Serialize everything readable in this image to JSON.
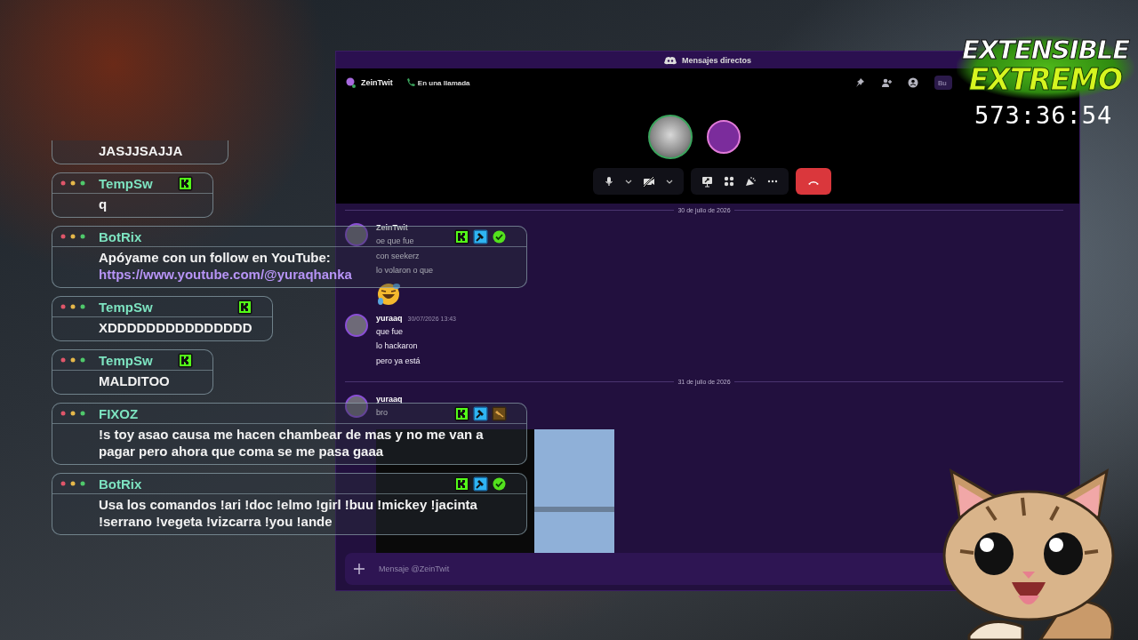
{
  "discord": {
    "title": "Mensajes directos",
    "channel": {
      "name": "ZeinTwit",
      "status": "En una llamada"
    },
    "search": {
      "placeholder": "Bu"
    },
    "messages": [
      {
        "kind": "divider",
        "text": "30 de julio de 2026"
      },
      {
        "kind": "group",
        "author": "ZeinTwit",
        "lines": [
          "oe que fue",
          "con seekerz",
          "lo volaron o que"
        ],
        "attachments": [
          {
            "kind": "emoji"
          }
        ]
      },
      {
        "kind": "group",
        "author": "yuraaq",
        "time": "30/07/2026 13:43",
        "lines": [
          "que fue",
          "lo hackaron",
          "pero ya está"
        ]
      },
      {
        "kind": "divider",
        "text": "31 de julio de 2026"
      },
      {
        "kind": "group",
        "author": "yuraaq",
        "lines": [
          "bro"
        ],
        "attachments": [
          {
            "kind": "image"
          }
        ]
      }
    ],
    "composer": {
      "placeholder": "Mensaje @ZeinTwit"
    }
  },
  "chat": [
    {
      "text": "JASJJSAJJA"
    },
    {
      "author": "TempSw",
      "badges": [
        {
          "kind": "kick"
        }
      ],
      "text": "q"
    },
    {
      "author": "BotRix",
      "badges": [
        {
          "kind": "kick"
        },
        {
          "kind": "mod"
        },
        {
          "kind": "verified"
        }
      ],
      "text": "Apóyame con un follow en YouTube:",
      "link": "https://www.youtube.com/@yuraqhanka"
    },
    {
      "author": "TempSw",
      "badges": [
        {
          "kind": "kick"
        }
      ],
      "text": "XDDDDDDDDDDDDDDD"
    },
    {
      "author": "TempSw",
      "badges": [
        {
          "kind": "kick"
        }
      ],
      "text": "MALDITOO"
    },
    {
      "author": "FIXOZ",
      "badges": [
        {
          "kind": "kick"
        },
        {
          "kind": "mod"
        },
        {
          "kind": "gavel"
        }
      ],
      "text": "!s toy asao causa me hacen chambear de mas y no me van a pagar pero ahora que coma se me pasa gaaa"
    },
    {
      "author": "BotRix",
      "badges": [
        {
          "kind": "kick"
        },
        {
          "kind": "mod"
        },
        {
          "kind": "verified"
        }
      ],
      "text": "Usa los comandos !ari !doc !elmo !girl !buu !mickey !jacinta !serrano !vegeta !vizcarra !you !ande"
    }
  ],
  "overlay": {
    "title_top": "EXTENSIBLE",
    "title_bottom": "EXTREMO",
    "timer": "573:36:54"
  }
}
